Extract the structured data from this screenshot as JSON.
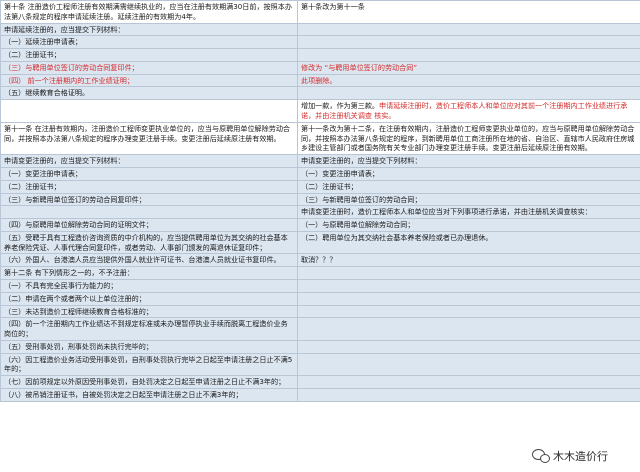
{
  "rows": [
    {
      "l": "第十条 注册造价工程师注册有效期满需继续执业的，应当在注册有效期满30日前，按照本办法第八条规定的程序申请延续注册。延续注册的有效期为4年。",
      "lc": "",
      "lb": "white",
      "r": "第十条改为第十一条",
      "rc": "",
      "rb": "white"
    },
    {
      "l": "申请延续注册的，应当提交下列材料：",
      "lc": "",
      "lb": "blue",
      "r": "",
      "rc": "",
      "rb": "blue"
    },
    {
      "l": "（一）延续注册申请表；",
      "lc": "",
      "lb": "blue",
      "r": "",
      "rc": "",
      "rb": "blue"
    },
    {
      "l": "（二）注册证书；",
      "lc": "",
      "lb": "blue",
      "r": "",
      "rc": "",
      "rb": "blue"
    },
    {
      "l": "（三）与聘用单位签订的劳动合同复印件；",
      "lc": "red",
      "lb": "blue",
      "r": "修改为 “与聘用单位签订的劳动合同”",
      "rc": "red",
      "rb": "blue"
    },
    {
      "l": "（四） 前一个注册期内的工作业绩证明；",
      "lc": "red",
      "lb": "blue",
      "r": "此项删除。",
      "rc": "red",
      "rb": "blue"
    },
    {
      "l": "（五）继续教育合格证明。",
      "lc": "",
      "lb": "blue",
      "r": "",
      "rc": "",
      "rb": "blue"
    },
    {
      "l": "",
      "lc": "",
      "lb": "white",
      "r": "",
      "rseg": [
        {
          "t": "增加一款，作为第三款。",
          "c": ""
        },
        {
          "t": "申请延续注册时，造价工程师本人和单位应对其前一个注册期内工作业绩进行承诺，并由注册机关调查 核实。",
          "c": "red"
        }
      ],
      "rb": "white"
    },
    {
      "l": "第十一条 在注册有效期内，注册造价工程师变更执业单位的，应当与原聘用单位解除劳动合同，并按照本办法第八条规定的程序办理变更注册手续。变更注册后延续原注册有效期。",
      "lc": "",
      "lb": "white",
      "r": "第十一条改为第十二条，在注册有效期内，注册造价工程师变更执业单位的，应当与原聘用单位解除劳动合同，并按照本办法第八条规定的程序，到新聘用单位工商注册所在地的省、自治区、直辖市人民政府住房城乡建设主管部门或者国务院有关专业部门办理变更注册手续。变更注册后延续原注册有效期。",
      "rc": "",
      "rb": "white"
    },
    {
      "l": "申请变更注册的，应当提交下列材料：",
      "lc": "",
      "lb": "blue",
      "r": "申请变更注册的，应当提交下列材料：",
      "rc": "",
      "rb": "blue"
    },
    {
      "l": "（一）变更注册申请表；",
      "lc": "",
      "lb": "blue",
      "r": "（一）变更注册申请表；",
      "rc": "",
      "rb": "blue"
    },
    {
      "l": "（二）注册证书；",
      "lc": "",
      "lb": "blue",
      "r": "（二）注册证书；",
      "rc": "",
      "rb": "blue"
    },
    {
      "l": "（三）与新聘用单位签订的劳动合同复印件；",
      "lc": "",
      "lb": "blue",
      "r": "（三）与新聘用单位签订的劳动合同；",
      "rc": "",
      "rb": "blue"
    },
    {
      "l": "",
      "lc": "",
      "lb": "blue",
      "r": "申请变更注册时，造价工程师本人和单位应当对下列事项进行承诺，并由注册机关调查核实：",
      "rc": "",
      "rb": "blue"
    },
    {
      "l": "（四）与原聘用单位解除劳动合同的证明文件；",
      "lc": "",
      "lb": "blue",
      "r": "（一）与原聘用单位解除劳动合同；",
      "rc": "",
      "rb": "blue"
    },
    {
      "l": "（五）受聘于具有工程造价咨询资质的中介机构的，应当提供聘用单位为其交纳的社会基本养老保险凭证、人事代理合同复印件，或者劳动、人事部门颁发的离退休证复印件；",
      "lc": "",
      "lb": "blue",
      "r": "（二）聘用单位为其交纳社会基本养老保险或者已办理退休。",
      "rc": "",
      "rb": "blue"
    },
    {
      "l": "（六）外国人、台港澳人员应当提供外国人就业许可证书、台港澳人员就业证书复印件。",
      "lc": "",
      "lb": "blue",
      "r": "取消？？？",
      "rc": "",
      "rb": "blue"
    },
    {
      "l": "第十二条 有下列情形之一的，不予注册：",
      "lc": "",
      "lb": "blue",
      "r": "",
      "rc": "",
      "rb": "blue"
    },
    {
      "l": "（一）不具有完全民事行为能力的；",
      "lc": "",
      "lb": "blue",
      "r": "",
      "rc": "",
      "rb": "blue"
    },
    {
      "l": "（二）申请在两个或者两个以上单位注册的；",
      "lc": "",
      "lb": "blue",
      "r": "",
      "rc": "",
      "rb": "blue"
    },
    {
      "l": "（三）未达到造价工程师继续教育合格标准的；",
      "lc": "",
      "lb": "blue",
      "r": "",
      "rc": "",
      "rb": "blue"
    },
    {
      "l": "（四）前一个注册期内工作业绩达不到规定标准或未办理暂停执业手续而脱离工程造价业务岗位的；",
      "lc": "",
      "lb": "blue",
      "r": "",
      "rc": "",
      "rb": "blue"
    },
    {
      "l": "（五）受刑事处罚，刑事处罚尚未执行完毕的；",
      "lc": "",
      "lb": "blue",
      "r": "",
      "rc": "",
      "rb": "blue"
    },
    {
      "l": "（六）因工程造价业务活动受刑事处罚，自刑事处罚执行完毕之日起至申请注册之日止不满5年的；",
      "lc": "",
      "lb": "blue",
      "r": "",
      "rc": "",
      "rb": "blue"
    },
    {
      "l": "（七）因前项规定以外原因受刑事处罚，自处罚决定之日起至申请注册之日止不满3年的；",
      "lc": "",
      "lb": "blue",
      "r": "",
      "rc": "",
      "rb": "blue"
    },
    {
      "l": "（八）被吊销注册证书，自被处罚决定之日起至申请注册之日止不满3年的；",
      "lc": "",
      "lb": "blue",
      "r": "",
      "rc": "",
      "rb": "blue"
    }
  ],
  "watermark": {
    "text": "木木造价行"
  }
}
